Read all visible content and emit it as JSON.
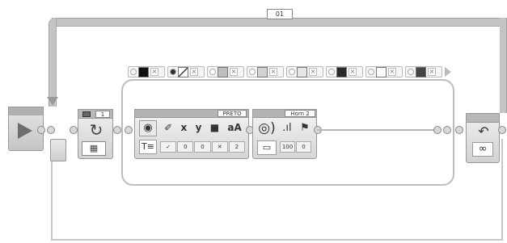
{
  "loop": {
    "label": "01"
  },
  "loop_start": {
    "count_label": "1"
  },
  "display_block": {
    "port_label": "PRETO",
    "param_icons": [
      "✐",
      "x",
      "y",
      "■",
      "aA"
    ],
    "param_values": [
      "✓",
      "0",
      "0",
      "✕",
      "2"
    ]
  },
  "sound_block": {
    "port_label": "Horn 2",
    "param_icons": [
      ".ıl",
      "⚑"
    ],
    "param_values": [
      "100",
      "0"
    ]
  },
  "switch_cases": [
    {
      "color": "#111111",
      "selected": false
    },
    {
      "color": "none",
      "selected": true
    },
    {
      "color": "#bdbdbd",
      "selected": false
    },
    {
      "color": "#d2d2d2",
      "selected": false
    },
    {
      "color": "#e6e6e6",
      "selected": false
    },
    {
      "color": "#2a2a2a",
      "selected": false
    },
    {
      "color": "#ffffff",
      "selected": false
    },
    {
      "color": "#444444",
      "selected": false
    }
  ],
  "colors": {
    "frame": "#c4c4c4",
    "block_bar": "#b4b4b4",
    "wire": "#b8b8b8"
  }
}
